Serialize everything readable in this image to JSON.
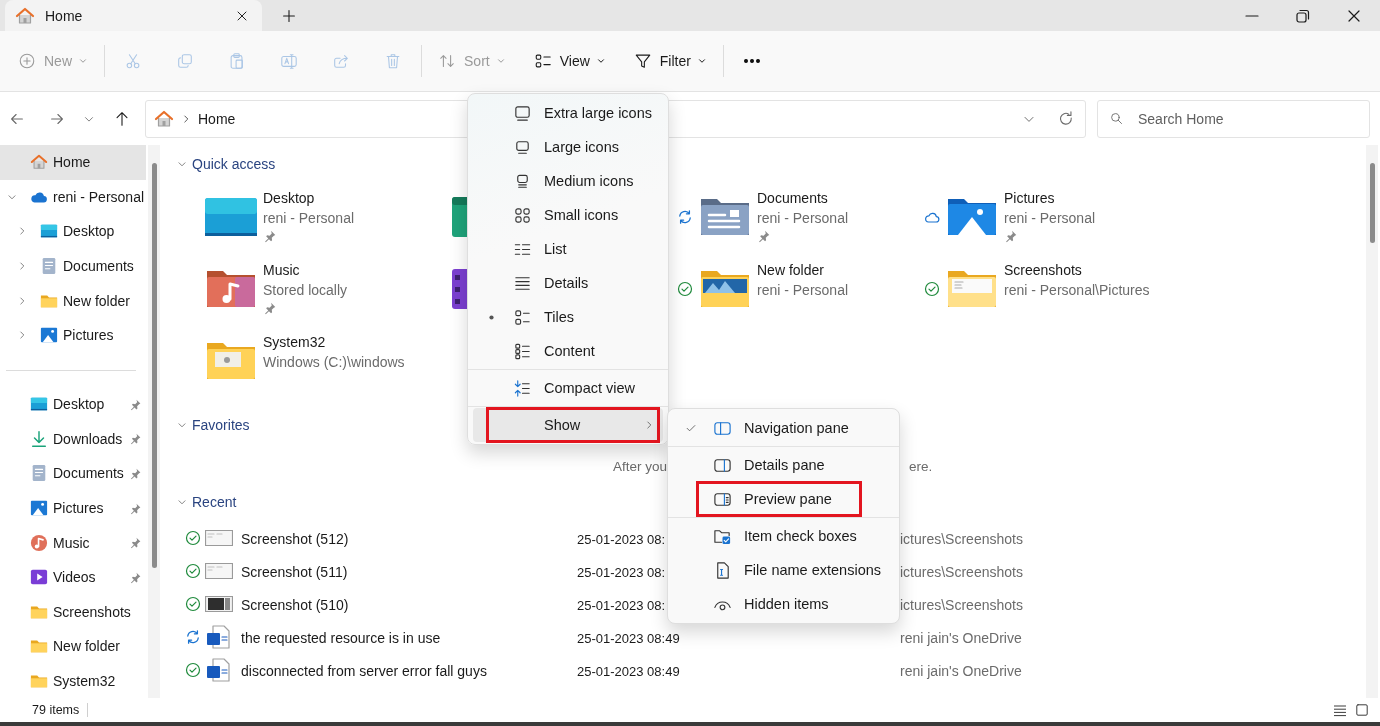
{
  "window": {
    "tab_title": "Home"
  },
  "toolbar": [
    {
      "kind": "menu",
      "label": "New",
      "disabled": true
    },
    {
      "kind": "divider"
    },
    {
      "kind": "icon",
      "disabled": true
    },
    {
      "kind": "icon",
      "disabled": true
    },
    {
      "kind": "icon",
      "disabled": true
    },
    {
      "kind": "icon",
      "disabled": true
    },
    {
      "kind": "icon",
      "disabled": true
    },
    {
      "kind": "icon",
      "disabled": true
    },
    {
      "kind": "divider"
    },
    {
      "kind": "menu",
      "label": "Sort",
      "disabled": true
    },
    {
      "kind": "menu",
      "label": "View",
      "disabled": false
    },
    {
      "kind": "menu",
      "label": "Filter",
      "disabled": false
    },
    {
      "kind": "divider"
    },
    {
      "kind": "icon",
      "disabled": false
    }
  ],
  "address": {
    "crumb": "Home",
    "search_placeholder": "Search Home"
  },
  "sidebar": {
    "tree": [
      {
        "label": "Home",
        "selected": true
      },
      {
        "label": "reni - Personal",
        "selected": false,
        "expanded": true,
        "children": [
          {
            "label": "Desktop",
            "selected": false,
            "expanded": false
          },
          {
            "label": "Documents",
            "selected": false,
            "expanded": false
          },
          {
            "label": "New folder",
            "selected": false,
            "expanded": false
          },
          {
            "label": "Pictures",
            "selected": false,
            "expanded": false
          }
        ]
      }
    ],
    "pinned": [
      {
        "label": "Desktop",
        "selected": false,
        "pinned": true
      },
      {
        "label": "Downloads",
        "selected": false,
        "pinned": true
      },
      {
        "label": "Documents",
        "selected": false,
        "pinned": true
      },
      {
        "label": "Pictures",
        "selected": false,
        "pinned": true
      },
      {
        "label": "Music",
        "selected": false,
        "pinned": true
      },
      {
        "label": "Videos",
        "selected": false,
        "pinned": true
      },
      {
        "label": "Screenshots",
        "selected": false,
        "pinned": false
      },
      {
        "label": "New folder",
        "selected": false,
        "pinned": false
      },
      {
        "label": "System32",
        "selected": false,
        "pinned": false
      }
    ]
  },
  "quick_access": {
    "title": "Quick access",
    "expanded": true,
    "tiles": [
      {
        "kind": "folder",
        "name": "Desktop",
        "location": "reni - Personal",
        "syncing": false,
        "cloud_only": false,
        "available": false,
        "pinned": true
      },
      {
        "kind": "covered"
      },
      {
        "kind": "folder",
        "name": "Documents",
        "location": "reni - Personal",
        "syncing": true,
        "cloud_only": false,
        "available": false,
        "pinned": true
      },
      {
        "kind": "folder",
        "name": "Pictures",
        "location": "reni - Personal",
        "syncing": false,
        "cloud_only": true,
        "available": false,
        "pinned": true
      },
      {
        "kind": "folder",
        "name": "Music",
        "location": "Stored locally",
        "syncing": false,
        "cloud_only": false,
        "available": false,
        "pinned": true
      },
      {
        "kind": "covered"
      },
      {
        "kind": "folder",
        "name": "New folder",
        "location": "reni - Personal",
        "syncing": false,
        "cloud_only": false,
        "available": true,
        "pinned": false
      },
      {
        "kind": "folder",
        "name": "Screenshots",
        "location": "reni - Personal\\Pictures",
        "syncing": false,
        "cloud_only": false,
        "available": true,
        "pinned": false
      },
      {
        "kind": "folder",
        "name": "System32",
        "location": "Windows (C:)\\windows",
        "syncing": false,
        "cloud_only": false,
        "available": false,
        "pinned": false
      }
    ]
  },
  "favorites": {
    "title": "Favorites",
    "expanded": true,
    "message_parts": [
      "After you",
      "ere."
    ]
  },
  "recent": {
    "title": "Recent",
    "expanded": true,
    "rows": [
      {
        "syncing": false,
        "available": true,
        "name": "Screenshot (512)",
        "date": "25-01-2023 08:",
        "location": "ictures\\Screenshots"
      },
      {
        "syncing": false,
        "available": true,
        "name": "Screenshot (511)",
        "date": "25-01-2023 08:",
        "location": "ictures\\Screenshots"
      },
      {
        "syncing": false,
        "available": true,
        "name": "Screenshot (510)",
        "date": "25-01-2023 08:",
        "location": "ictures\\Screenshots"
      },
      {
        "syncing": true,
        "available": false,
        "name": "the requested resource is in use",
        "date": "25-01-2023 08:49",
        "location": "reni jain's OneDrive"
      },
      {
        "syncing": false,
        "available": true,
        "name": "disconnected from server error fall guys",
        "date": "25-01-2023 08:49",
        "location": "reni jain's OneDrive"
      }
    ]
  },
  "view_menu": [
    {
      "kind": "view",
      "label": "Extra large icons",
      "selected": false
    },
    {
      "kind": "view",
      "label": "Large icons",
      "selected": false
    },
    {
      "kind": "view",
      "label": "Medium icons",
      "selected": false
    },
    {
      "kind": "view",
      "label": "Small icons",
      "selected": false
    },
    {
      "kind": "view",
      "label": "List",
      "selected": false
    },
    {
      "kind": "view",
      "label": "Details",
      "selected": false
    },
    {
      "kind": "view",
      "label": "Tiles",
      "selected": true
    },
    {
      "kind": "view",
      "label": "Content",
      "selected": false
    },
    {
      "kind": "divider"
    },
    {
      "kind": "toggle",
      "label": "Compact view",
      "checked": false
    },
    {
      "kind": "divider"
    },
    {
      "kind": "submenu",
      "label": "Show",
      "hovered": true,
      "highlighted": true
    }
  ],
  "show_menu": [
    {
      "kind": "toggle",
      "label": "Navigation pane",
      "checked": true,
      "highlighted": false
    },
    {
      "kind": "divider"
    },
    {
      "kind": "toggle",
      "label": "Details pane",
      "checked": false,
      "highlighted": false
    },
    {
      "kind": "toggle",
      "label": "Preview pane",
      "checked": false,
      "highlighted": true
    },
    {
      "kind": "divider"
    },
    {
      "kind": "toggle",
      "label": "Item check boxes",
      "checked": false,
      "highlighted": false
    },
    {
      "kind": "toggle",
      "label": "File name extensions",
      "checked": false,
      "highlighted": false
    },
    {
      "kind": "toggle",
      "label": "Hidden items",
      "checked": false,
      "highlighted": false
    }
  ],
  "status_bar": {
    "count": "79 items"
  }
}
